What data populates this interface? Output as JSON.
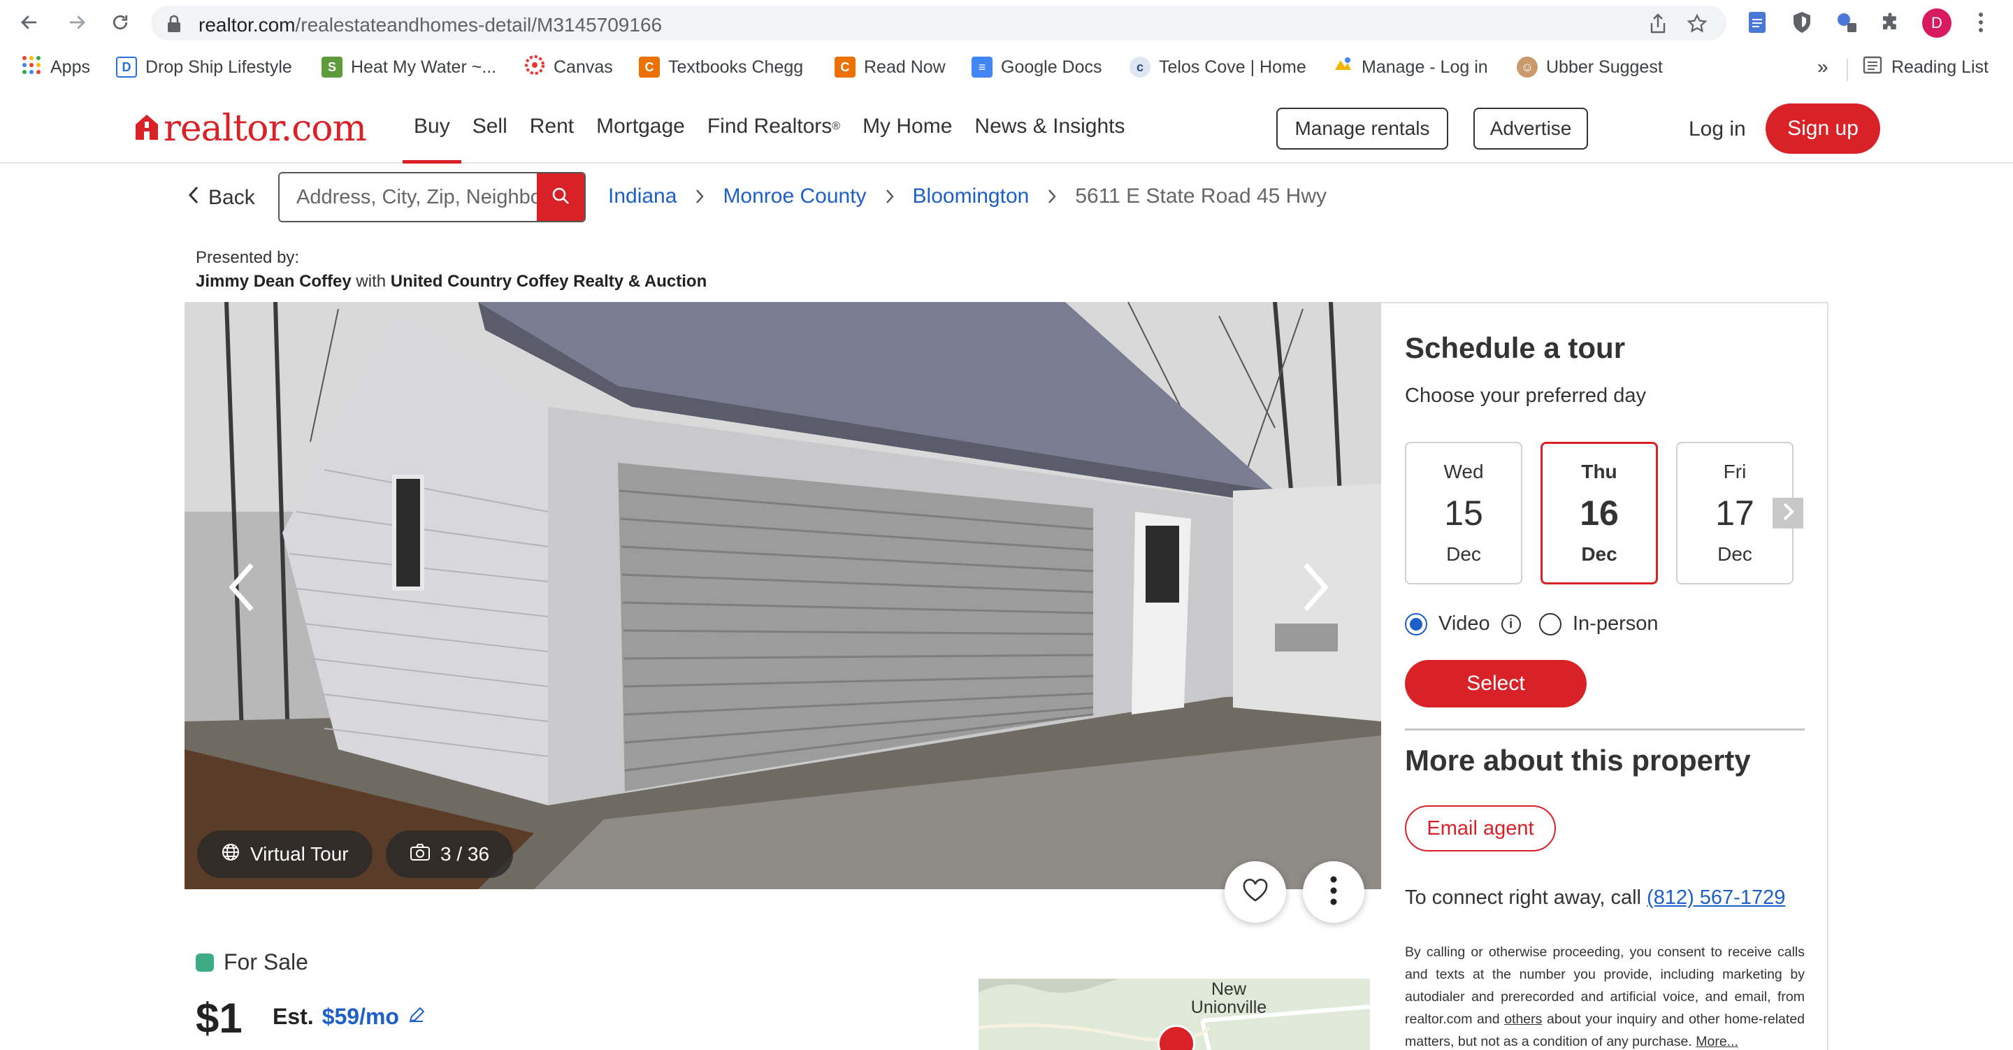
{
  "browser": {
    "url_host": "realtor.com",
    "url_path": "/realestateandhomes-detail/M3145709166",
    "profile_initial": "D",
    "bookmarks": [
      {
        "label": "Apps",
        "icon": "apps-grid-icon"
      },
      {
        "label": "Drop Ship Lifestyle",
        "icon": "dropship-icon"
      },
      {
        "label": "Heat My Water ~...",
        "icon": "shopify-icon"
      },
      {
        "label": "Canvas",
        "icon": "canvas-icon"
      },
      {
        "label": "Textbooks Chegg",
        "icon": "chegg-icon"
      },
      {
        "label": "Read Now",
        "icon": "chegg-icon"
      },
      {
        "label": "Google Docs",
        "icon": "google-docs-icon"
      },
      {
        "label": "Telos Cove | Home",
        "icon": "telos-icon"
      },
      {
        "label": "Manage - Log in",
        "icon": "manage-icon"
      },
      {
        "label": "Ubber Suggest",
        "icon": "ubersuggest-icon"
      }
    ],
    "more_label": "»",
    "reading_list": "Reading List"
  },
  "site": {
    "logo": "realtor.com",
    "nav": [
      {
        "label": "Buy",
        "active": true
      },
      {
        "label": "Sell"
      },
      {
        "label": "Rent"
      },
      {
        "label": "Mortgage"
      },
      {
        "label": "Find Realtors",
        "sup": "®"
      },
      {
        "label": "My Home"
      },
      {
        "label": "News & Insights"
      }
    ],
    "manage_rentals": "Manage rentals",
    "advertise": "Advertise",
    "login": "Log in",
    "signup": "Sign up",
    "brand_color": "#d92228"
  },
  "search": {
    "back_label": "Back",
    "placeholder": "Address, City, Zip, Neighborhood"
  },
  "breadcrumb": {
    "links": [
      "Indiana",
      "Monroe County",
      "Bloomington"
    ],
    "current": "5611 E State Road 45 Hwy"
  },
  "presented": {
    "label": "Presented by:",
    "agent": "Jimmy Dean Coffey",
    "with": "with",
    "office": "United Country Coffey Realty & Auction"
  },
  "photo": {
    "virtual_tour": "Virtual Tour",
    "counter": "3 / 36"
  },
  "tour": {
    "title": "Schedule a tour",
    "subtitle": "Choose your preferred day",
    "days": [
      {
        "dow": "Wed",
        "num": "15",
        "mon": "Dec",
        "selected": false
      },
      {
        "dow": "Thu",
        "num": "16",
        "mon": "Dec",
        "selected": true
      },
      {
        "dow": "Fri",
        "num": "17",
        "mon": "Dec",
        "selected": false
      }
    ],
    "option_video": "Video",
    "option_inperson": "In-person",
    "select_label": "Select"
  },
  "more": {
    "title": "More about this property",
    "email_agent": "Email agent",
    "connect_text": "To connect right away, call",
    "phone": "(812) 567-1729",
    "consent_1": "By calling or otherwise proceeding, you consent to receive calls and texts at the number you provide, including marketing by autodialer and prerecorded and artificial voice, and email, from realtor.com and",
    "consent_others": "others",
    "consent_2": "about your inquiry and other home-related matters, but not as a condition of any purchase.",
    "consent_more": "More..."
  },
  "listing": {
    "status": "For Sale",
    "price": "$1",
    "est_label": "Est.",
    "est_value": "$59/mo",
    "status_color": "#3dac84"
  },
  "map": {
    "label_line1": "New",
    "label_line2": "Unionville"
  }
}
